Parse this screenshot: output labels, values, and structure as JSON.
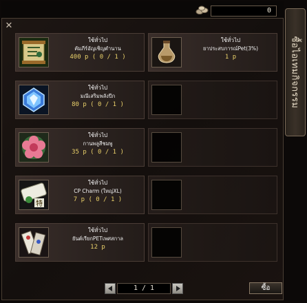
{
  "header": {
    "money_value": "0",
    "side_tab_label": "ซื้อไอเทมกิจกรรม"
  },
  "items": [
    {
      "category": "ใช้ทั่วไป",
      "name": "คัมภีร์อัญเชิญตำนาน",
      "price": "400 p ( 0 / 1 )",
      "icon": "scroll-icon"
    },
    {
      "category": "ใช้ทั่วไป",
      "name": "ยาประสบการณ์Pet(3%)",
      "price": "1 p",
      "icon": "potion-icon"
    },
    {
      "category": "ใช้ทั่วไป",
      "name": "มณีเสริมพลังปีก",
      "price": "80 p ( 0 / 1 )",
      "icon": "gem-icon"
    },
    {
      "category": "ใช้ทั่วไป",
      "name": "กานพลูสีชมพู",
      "price": "35 p ( 0 / 1 )",
      "icon": "flower-icon"
    },
    {
      "category": "ใช้ทั่วไป",
      "name": "CP Charm (ใหญ่XL)",
      "price": "7 p ( 0 / 1 )",
      "icon": "charm-icon"
    },
    {
      "category": "ใช้ทั่วไป",
      "name": "ยันต์เรียกPETเพศสกาล",
      "price": "12 p",
      "icon": "talisman-icon"
    }
  ],
  "pagination": {
    "text": "1 / 1"
  },
  "buttons": {
    "buy": "ซื้อ",
    "close": "✕"
  }
}
